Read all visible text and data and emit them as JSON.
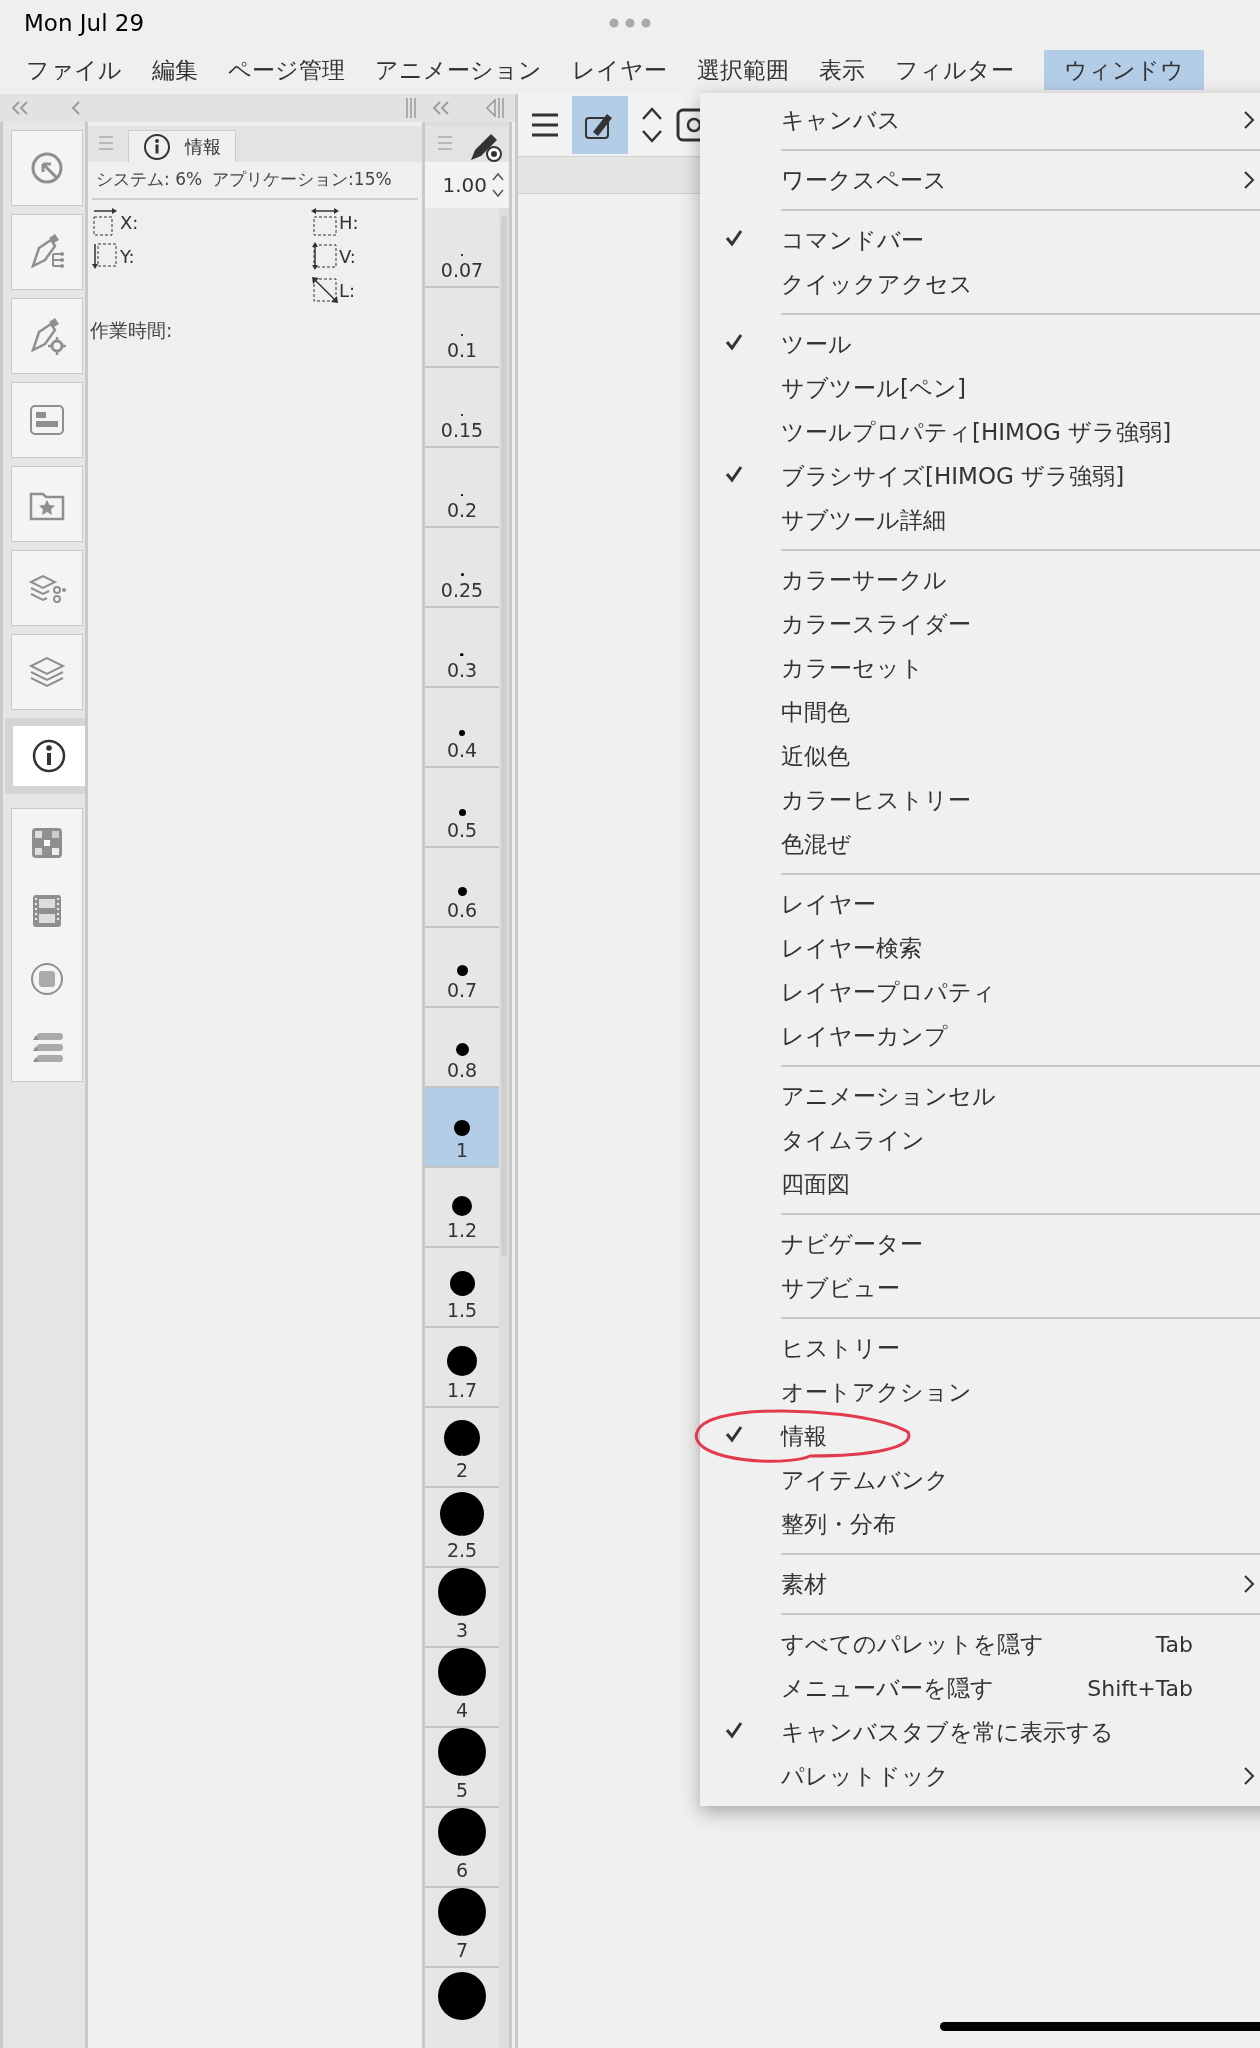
{
  "status_bar": {
    "time": "Mon Jul 29"
  },
  "menu_bar": [
    {
      "label": "ファイル",
      "selected": false
    },
    {
      "label": "編集",
      "selected": false
    },
    {
      "label": "ページ管理",
      "selected": false
    },
    {
      "label": "アニメーション",
      "selected": false
    },
    {
      "label": "レイヤー",
      "selected": false
    },
    {
      "label": "選択範囲",
      "selected": false
    },
    {
      "label": "表示",
      "selected": false
    },
    {
      "label": "フィルター",
      "selected": false
    },
    {
      "label": "ウィンドウ",
      "selected": true
    }
  ],
  "left_dock": [
    {
      "kind": "navigator",
      "selected": false
    },
    {
      "kind": "subtool",
      "selected": false
    },
    {
      "kind": "tool-property",
      "selected": false
    },
    {
      "kind": "brush-size",
      "selected": false
    },
    {
      "kind": "material",
      "selected": false
    },
    {
      "kind": "layer-property",
      "selected": false
    },
    {
      "kind": "layer",
      "selected": false
    },
    {
      "kind": "info",
      "selected": true
    },
    {
      "kind": "color-set",
      "selected": false
    },
    {
      "kind": "timeline",
      "selected": false
    },
    {
      "kind": "color-slider",
      "selected": false
    },
    {
      "kind": "history",
      "selected": false
    }
  ],
  "info_palette": {
    "tab": {
      "label": "情報",
      "selected": true
    },
    "system_usage": "システム: 6%",
    "app_usage": "アプリケーション:15%",
    "fields": [
      "X:",
      "H:",
      "Y:",
      "V:",
      "L:"
    ],
    "work_time": "作業時間:"
  },
  "brush_size": {
    "value": "1.00",
    "sizes": [
      {
        "label": "0.07",
        "selected": false
      },
      {
        "label": "0.1",
        "selected": false
      },
      {
        "label": "0.15",
        "selected": false
      },
      {
        "label": "0.2",
        "selected": false
      },
      {
        "label": "0.25",
        "selected": false
      },
      {
        "label": "0.3",
        "selected": false
      },
      {
        "label": "0.4",
        "selected": false
      },
      {
        "label": "0.5",
        "selected": false
      },
      {
        "label": "0.6",
        "selected": false
      },
      {
        "label": "0.7",
        "selected": false
      },
      {
        "label": "0.8",
        "selected": false
      },
      {
        "label": "1",
        "selected": true
      },
      {
        "label": "1.2",
        "selected": false
      },
      {
        "label": "1.5",
        "selected": false
      },
      {
        "label": "1.7",
        "selected": false
      },
      {
        "label": "2",
        "selected": false
      },
      {
        "label": "2.5",
        "selected": false
      },
      {
        "label": "3",
        "selected": false
      },
      {
        "label": "4",
        "selected": false
      },
      {
        "label": "5",
        "selected": false
      },
      {
        "label": "6",
        "selected": false
      },
      {
        "label": "7",
        "selected": false
      }
    ]
  },
  "window_menu": {
    "groups": [
      [
        {
          "label": "キャンバス",
          "checked": false,
          "submenu": true
        }
      ],
      [
        {
          "label": "ワークスペース",
          "checked": false,
          "submenu": true
        }
      ],
      [
        {
          "label": "コマンドバー",
          "checked": true,
          "submenu": false
        },
        {
          "label": "クイックアクセス",
          "checked": false,
          "submenu": false
        }
      ],
      [
        {
          "label": "ツール",
          "checked": true,
          "submenu": false
        },
        {
          "label": "サブツール[ペン]",
          "checked": false,
          "submenu": false
        },
        {
          "label": "ツールプロパティ[HIMOG ザラ強弱]",
          "checked": false,
          "submenu": false
        },
        {
          "label": "ブラシサイズ[HIMOG ザラ強弱]",
          "checked": true,
          "submenu": false
        },
        {
          "label": "サブツール詳細",
          "checked": false,
          "submenu": false
        }
      ],
      [
        {
          "label": "カラーサークル",
          "checked": false,
          "submenu": false
        },
        {
          "label": "カラースライダー",
          "checked": false,
          "submenu": false
        },
        {
          "label": "カラーセット",
          "checked": false,
          "submenu": false
        },
        {
          "label": "中間色",
          "checked": false,
          "submenu": false
        },
        {
          "label": "近似色",
          "checked": false,
          "submenu": false
        },
        {
          "label": "カラーヒストリー",
          "checked": false,
          "submenu": false
        },
        {
          "label": "色混ぜ",
          "checked": false,
          "submenu": false
        }
      ],
      [
        {
          "label": "レイヤー",
          "checked": false,
          "submenu": false
        },
        {
          "label": "レイヤー検索",
          "checked": false,
          "submenu": false
        },
        {
          "label": "レイヤープロパティ",
          "checked": false,
          "submenu": false
        },
        {
          "label": "レイヤーカンプ",
          "checked": false,
          "submenu": false
        }
      ],
      [
        {
          "label": "アニメーションセル",
          "checked": false,
          "submenu": false
        },
        {
          "label": "タイムライン",
          "checked": false,
          "submenu": false
        },
        {
          "label": "四面図",
          "checked": false,
          "submenu": false
        }
      ],
      [
        {
          "label": "ナビゲーター",
          "checked": false,
          "submenu": false
        },
        {
          "label": "サブビュー",
          "checked": false,
          "submenu": false
        }
      ],
      [
        {
          "label": "ヒストリー",
          "checked": false,
          "submenu": false
        },
        {
          "label": "オートアクション",
          "checked": false,
          "submenu": false
        },
        {
          "label": "情報",
          "checked": true,
          "submenu": false
        },
        {
          "label": "アイテムバンク",
          "checked": false,
          "submenu": false
        },
        {
          "label": "整列・分布",
          "checked": false,
          "submenu": false
        }
      ],
      [
        {
          "label": "素材",
          "checked": false,
          "submenu": true
        }
      ],
      [
        {
          "label": "すべてのパレットを隠す",
          "checked": false,
          "submenu": false,
          "shortcut": "Tab"
        },
        {
          "label": "メニューバーを隠す",
          "checked": false,
          "submenu": false,
          "shortcut": "Shift+Tab"
        },
        {
          "label": "キャンバスタブを常に表示する",
          "checked": true,
          "submenu": false
        },
        {
          "label": "パレットドック",
          "checked": false,
          "submenu": true
        }
      ]
    ]
  }
}
